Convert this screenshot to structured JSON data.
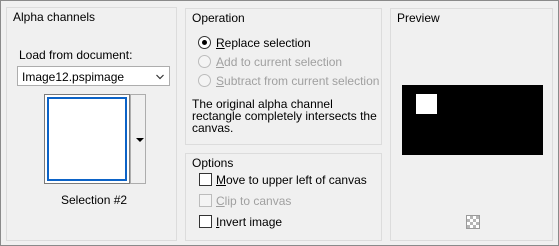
{
  "alpha_channels": {
    "title": "Alpha channels",
    "load_from_label": "Load from document:",
    "document": "Image12.pspimage",
    "selection_label": "Selection #2"
  },
  "operation": {
    "title": "Operation",
    "options": [
      {
        "pre": "",
        "key": "R",
        "rest": "eplace selection",
        "selected": true,
        "enabled": true
      },
      {
        "pre": "",
        "key": "A",
        "rest": "dd to current selection",
        "selected": false,
        "enabled": false
      },
      {
        "pre": "",
        "key": "S",
        "rest": "ubtract from current selection",
        "selected": false,
        "enabled": false
      }
    ],
    "description": "The original alpha channel\nrectangle completely intersects the\ncanvas."
  },
  "options": {
    "title": "Options",
    "items": [
      {
        "pre": "",
        "key": "M",
        "rest": "ove to upper left of canvas",
        "checked": false,
        "enabled": true
      },
      {
        "pre": "",
        "key": "C",
        "rest": "lip to canvas",
        "checked": false,
        "enabled": false
      },
      {
        "pre": "",
        "key": "I",
        "rest": "nvert image",
        "checked": false,
        "enabled": true
      }
    ]
  },
  "preview": {
    "title": "Preview",
    "canvas_color": "#000000",
    "selection_color": "#ffffff"
  }
}
